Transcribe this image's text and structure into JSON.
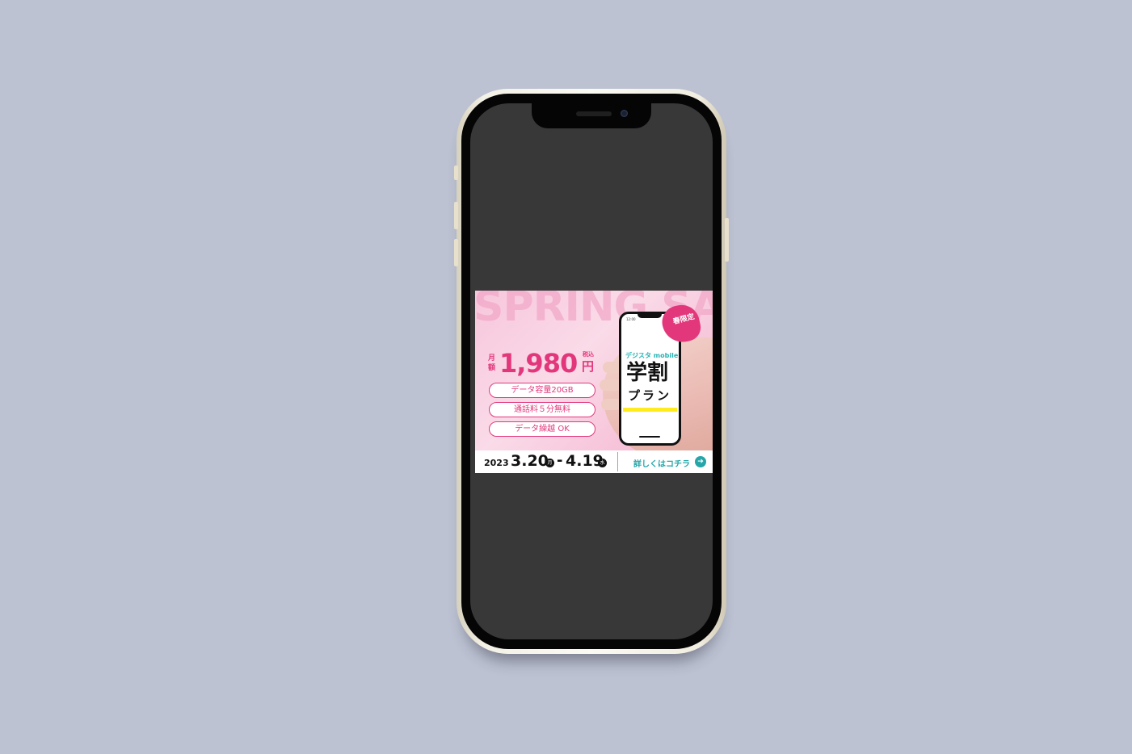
{
  "banner": {
    "headline": "SPRING SALE",
    "price": {
      "prefix": "月額",
      "amount": "1,980",
      "tax_note": "税込",
      "unit": "円"
    },
    "features": [
      "データ容量20GB",
      "通話料５分無料",
      "データ繰越 OK"
    ],
    "badge": "春限定",
    "mini_phone": {
      "time": "12:00",
      "brand": "デジスタ mobile",
      "title": "学割",
      "subtitle": "プラン"
    },
    "period": {
      "year": "2023",
      "start": "3.20",
      "start_day": "月",
      "separator": "-",
      "end": "4.19",
      "end_day": "水"
    },
    "cta": "詳しくはコチラ",
    "cta_icon": "arrow-right-icon"
  },
  "colors": {
    "accent_pink": "#e3377c",
    "accent_teal": "#26a6a8",
    "highlight_yellow": "#ffec1f",
    "background": "#bcc2d2"
  }
}
